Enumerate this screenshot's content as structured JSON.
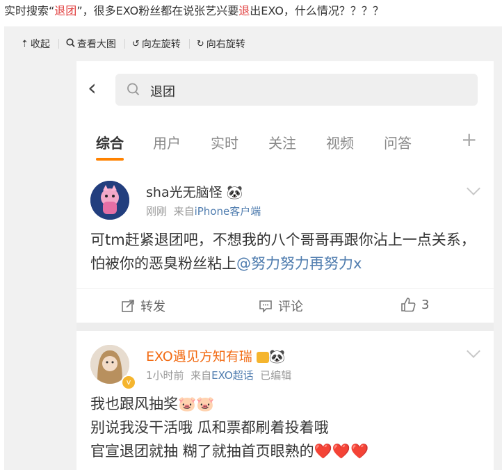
{
  "headline": {
    "part1": "实时搜索“",
    "highlight1": "退团",
    "part2": "”，很多EXO粉丝都在说张艺兴要",
    "highlight2": "退",
    "part3": "出EXO，什么情况？？？？"
  },
  "toolbar": {
    "collapse": "收起",
    "view_large": "查看大图",
    "rotate_left": "向左旋转",
    "rotate_right": "向右旋转"
  },
  "search": {
    "query": "退团"
  },
  "tabs": [
    "综合",
    "用户",
    "实时",
    "关注",
    "视频",
    "问答"
  ],
  "posts": [
    {
      "username": "sha光无脑怪",
      "badge": "🐼",
      "time": "刚刚",
      "source_prefix": "来自",
      "source": "iPhone客户端",
      "text_main": "可tm赶紧退团吧，不想我的八个哥哥再跟你沾上一点关系，怕被你的恶臭粉丝粘上",
      "mention": "@努力努力再努力x",
      "repost": "转发",
      "comment": "评论",
      "likes": "3"
    },
    {
      "username": "EXO遇见方知有瑞",
      "badge": "🐼",
      "time": "1小时前",
      "source_prefix": "来自",
      "source": "EXO超话",
      "edited": "已编辑",
      "line1": "我也跟风抽奖",
      "line2": "别说我没干活哦 瓜和票都刷着投着哦",
      "line3": "官宣退团就抽 糊了就抽首页眼熟的",
      "emoji1": "🐷🐷",
      "emoji3": "❤️❤️❤️"
    }
  ]
}
